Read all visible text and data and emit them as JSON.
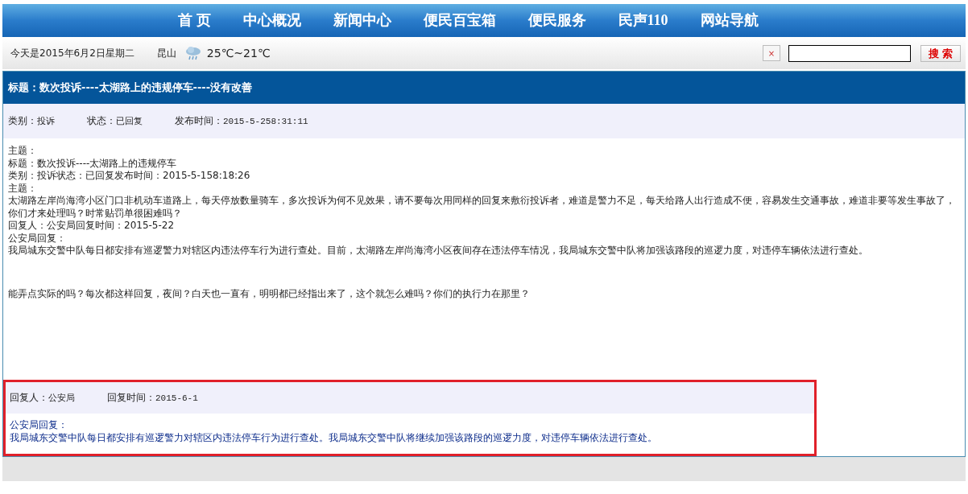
{
  "nav": {
    "items": [
      {
        "label": "首 页"
      },
      {
        "label": "中心概况"
      },
      {
        "label": "新闻中心"
      },
      {
        "label": "便民百宝箱"
      },
      {
        "label": "便民服务"
      },
      {
        "label": "民声110"
      },
      {
        "label": "网站导航"
      }
    ]
  },
  "info_bar": {
    "date": "今天是2015年6月2日星期二",
    "city": "昆山",
    "temperature": "25℃~21℃",
    "clear_button": "×",
    "search_button": "搜 索"
  },
  "post": {
    "title": "标题：数次投诉----太湖路上的违规停车----没有改善",
    "meta": [
      {
        "label": "类别：",
        "value": "投诉"
      },
      {
        "label": "状态：",
        "value": "已回复"
      },
      {
        "label": "发布时间：",
        "value": "2015-5-258:31:11"
      }
    ],
    "body": [
      {
        "kind": "line",
        "text": "主题："
      },
      {
        "kind": "line",
        "text": "标题：数次投诉----太湖路上的违规停车"
      },
      {
        "kind": "line",
        "text": "类别：投诉状态：已回复发布时间：2015-5-158:18:26"
      },
      {
        "kind": "line",
        "text": "主题："
      },
      {
        "kind": "line",
        "text": "太湖路左岸尚海湾小区门口非机动车道路上，每天停放数量骑车，多次投诉为何不见效果，请不要每次用同样的回复来敷衍投诉者，难道是警力不足，每天给路人出行造成不便，容易发生交通事故，难道非要等发生事故了，你们才来处理吗？时常贴罚单很困难吗？"
      },
      {
        "kind": "line",
        "text": "回复人：公安局回复时间：2015-5-22"
      },
      {
        "kind": "line",
        "text": "公安局回复："
      },
      {
        "kind": "line",
        "text": "我局城东交警中队每日都安排有巡逻警力对辖区内违法停车行为进行查处。目前，太湖路左岸尚海湾小区夜间存在违法停车情况，我局城东交警中队将加强该路段的巡逻力度，对违停车辆依法进行查处。"
      },
      {
        "kind": "after_gap",
        "text": "能弄点实际的吗？每次都这样回复，夜间？白天也一直有，明明都已经指出来了，这个就怎么难吗？你们的执行力在那里？"
      }
    ]
  },
  "reply": {
    "highlighted": true,
    "meta": [
      {
        "label": "回复人：",
        "value": "公安局"
      },
      {
        "label": "回复时间：",
        "value": "2015-6-1"
      }
    ],
    "heading": "公安局回复：",
    "text": "我局城东交警中队每日都安排有巡逻警力对辖区内违法停车行为进行查处。我局城东交警中队将继续加强该路段的巡逻力度，对违停车辆依法进行查处。"
  }
}
